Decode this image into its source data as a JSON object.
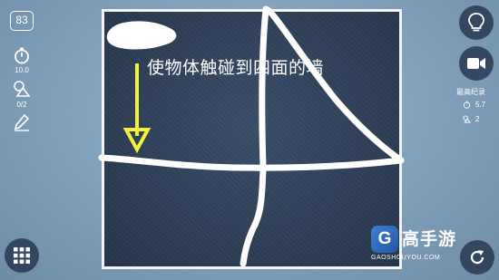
{
  "left_panel": {
    "level": "83",
    "time_limit": "10.0",
    "shapes_used": "0/2"
  },
  "board": {
    "hint_text": "使物体触碰到四面的墙"
  },
  "right_panel": {
    "best_record_label": "最高纪录",
    "best_time": "5.7",
    "best_shapes": "2"
  },
  "watermark": {
    "logo_letter": "G",
    "name": "高手游",
    "domain": "GAOSHOUYOU.COM"
  },
  "icons": {
    "timer": "stopwatch-icon",
    "shapes": "shapes-icon",
    "pencil": "pencil-icon",
    "hint": "lightbulb-icon",
    "video": "video-camera-icon",
    "menu": "grid-menu-icon",
    "restart": "restart-icon",
    "arrow": "down-arrow-icon"
  },
  "colors": {
    "background": "#8aa9c2",
    "board": "#2f4159",
    "drawn_lines": "#ffffff",
    "gravity_arrow": "#f5f03a",
    "button_bg": "#2c3e58"
  }
}
